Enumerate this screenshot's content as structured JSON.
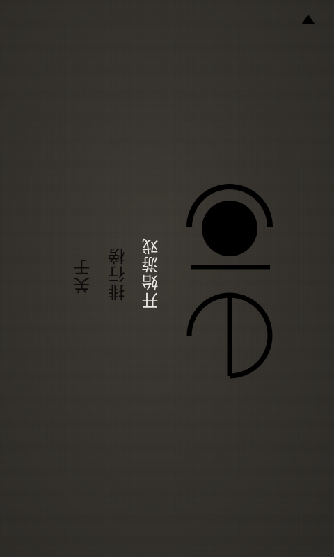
{
  "status_bar": {
    "icon": "signal-triangle-icon"
  },
  "logo": {
    "text": "core",
    "icon": "core-logo"
  },
  "menu": {
    "items": [
      {
        "label": "开始游戏",
        "selected": true
      },
      {
        "label": "排行榜",
        "selected": false
      },
      {
        "label": "关于",
        "selected": false
      }
    ]
  },
  "colors": {
    "background": "#35322d",
    "selected_text": "#e8e6e2",
    "text": "#0c0b0a",
    "logo": "#000000"
  }
}
